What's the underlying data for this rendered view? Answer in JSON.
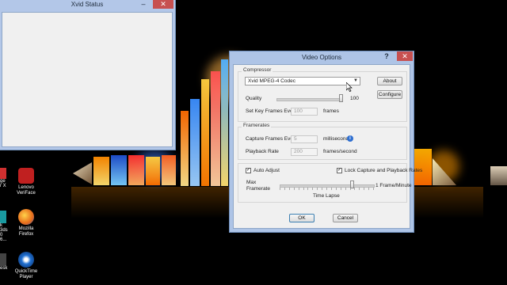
{
  "xvid_window": {
    "title": "Xvid Status",
    "min_glyph": "–",
    "close_glyph": "✕"
  },
  "dialog": {
    "title": "Video Options",
    "help_glyph": "?",
    "close_glyph": "✕",
    "compressor": {
      "group_label": "Compressor",
      "codec_value": "Xvid MPEG-4 Codec",
      "about_label": "About",
      "configure_label": "Configure",
      "quality_label": "Quality",
      "quality_value": "100",
      "quality_fraction": 1.0,
      "keyframes_label": "Set Key Frames Every",
      "keyframes_value": "100",
      "keyframes_unit": "frames"
    },
    "framerates": {
      "group_label": "Framerates",
      "capture_label": "Capture Frames Every",
      "capture_value": "5",
      "capture_unit": "milliseconds",
      "playback_label": "Playback Rate",
      "playback_value": "200",
      "playback_unit": "frames/second"
    },
    "auto_adjust": {
      "label": "Auto Adjust",
      "checked": true
    },
    "lock_rates": {
      "label": "Lock Capture and Playback Rates",
      "checked": true
    },
    "max_framerate": {
      "label_line1": "Max",
      "label_line2": "Framerate",
      "right_label": "1 Frame/Minute",
      "bottom_label": "Time Lapse",
      "slider_fraction": 0.77
    },
    "ok_label": "OK",
    "cancel_label": "Cancel"
  },
  "desktop_icons": [
    {
      "caption": "PowerDVD 10",
      "color": "#2a4f9a"
    },
    {
      "caption": "Lenovo\nVeriFace",
      "color": "#c02020"
    },
    {
      "caption": "Mozilla\nFirefox",
      "color": "#e66a1a"
    },
    {
      "caption": "QuickTime\nPlayer",
      "color": "#1f6fd0"
    }
  ],
  "desktop_left_fragments": [
    "ge",
    "r X",
    "k 3ds",
    "0 6...",
    "esk"
  ]
}
